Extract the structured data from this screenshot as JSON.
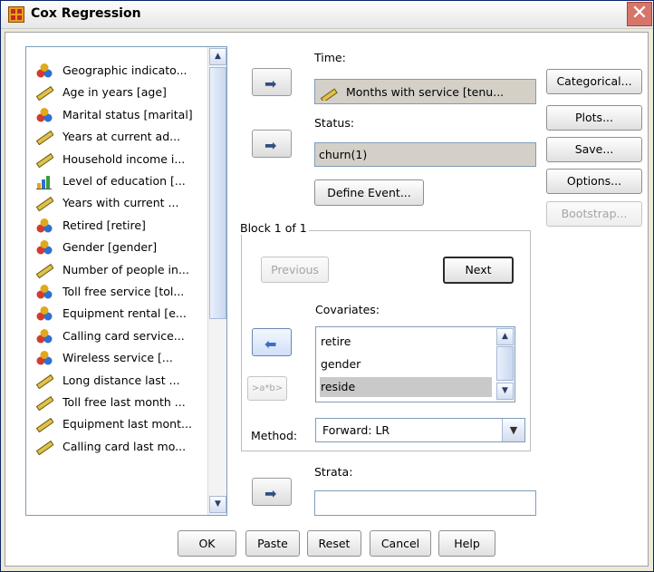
{
  "window": {
    "title": "Cox Regression",
    "close_glyph": "✕"
  },
  "variables": [
    {
      "label": "Geographic indicato...",
      "icon": "nominal-icon"
    },
    {
      "label": "Age in years [age]",
      "icon": "scale-icon"
    },
    {
      "label": "Marital status [marital]",
      "icon": "nominal-icon"
    },
    {
      "label": "Years at current ad...",
      "icon": "scale-icon"
    },
    {
      "label": "Household income i...",
      "icon": "scale-icon"
    },
    {
      "label": "Level of education [...",
      "icon": "ordinal-icon"
    },
    {
      "label": "Years with current ...",
      "icon": "scale-icon"
    },
    {
      "label": "Retired [retire]",
      "icon": "nominal-icon"
    },
    {
      "label": "Gender [gender]",
      "icon": "nominal-icon"
    },
    {
      "label": "Number of people in...",
      "icon": "scale-icon"
    },
    {
      "label": "Toll free service [tol...",
      "icon": "nominal-icon"
    },
    {
      "label": "Equipment rental [e...",
      "icon": "nominal-icon"
    },
    {
      "label": "Calling card service...",
      "icon": "nominal-icon"
    },
    {
      "label": "Wireless service [...",
      "icon": "nominal-icon"
    },
    {
      "label": "Long distance last ...",
      "icon": "scale-icon"
    },
    {
      "label": "Toll free last month ...",
      "icon": "scale-icon"
    },
    {
      "label": "Equipment last mont...",
      "icon": "scale-icon"
    },
    {
      "label": "Calling card last mo...",
      "icon": "scale-icon"
    }
  ],
  "time": {
    "label": "Time:",
    "value": "Months with service [tenu..."
  },
  "status": {
    "label": "Status:",
    "value": "churn(1)",
    "define_event": "Define Event..."
  },
  "block": {
    "title": "Block 1 of 1",
    "previous": "Previous",
    "next": "Next"
  },
  "covariates": {
    "label": "Covariates:",
    "items": [
      "retire",
      "gender",
      "reside"
    ],
    "selected": "reside"
  },
  "interaction_button": ">a*b>",
  "method": {
    "label": "Method:",
    "value": "Forward: LR"
  },
  "strata": {
    "label": "Strata:",
    "value": ""
  },
  "side_buttons": {
    "categorical": "Categorical...",
    "plots": "Plots...",
    "save": "Save...",
    "options": "Options...",
    "bootstrap": "Bootstrap..."
  },
  "bottom_buttons": {
    "ok": "OK",
    "paste": "Paste",
    "reset": "Reset",
    "cancel": "Cancel",
    "help": "Help"
  },
  "colors": {
    "title_bar": "#e6e6e6",
    "close_button": "#d7756a",
    "selection": "#c9c9c9",
    "disabled_text": "#a5a5a5"
  }
}
